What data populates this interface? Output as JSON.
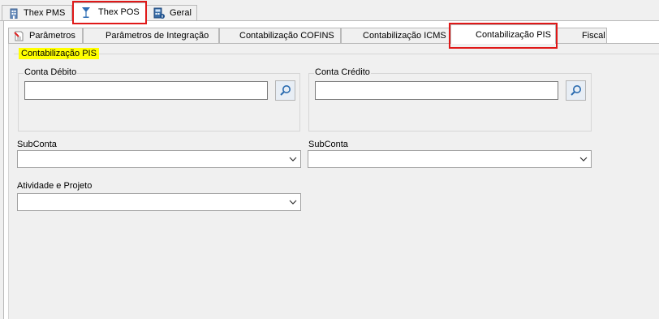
{
  "top_tabs": [
    {
      "label": "Thex PMS",
      "icon": "building-icon"
    },
    {
      "label": "Thex POS",
      "icon": "cocktail-glass-icon",
      "active": true
    },
    {
      "label": "Geral",
      "icon": "calculator-icon"
    }
  ],
  "inner_tabs": [
    {
      "label": "Parâmetros",
      "icon": "document-icon"
    },
    {
      "label": "Parâmetros de Integração"
    },
    {
      "label": "Contabilização COFINS"
    },
    {
      "label": "Contabilização ICMS"
    },
    {
      "label": "Contabilização PIS",
      "active": true
    },
    {
      "label": "Fiscal"
    }
  ],
  "group": {
    "title": "Contabilização PIS",
    "highlight_color": "#ffff00",
    "conta_debito": {
      "label": "Conta Débito",
      "value": ""
    },
    "conta_credito": {
      "label": "Conta Crédito",
      "value": ""
    },
    "subconta_debito": {
      "label": "SubConta",
      "value": ""
    },
    "subconta_credito": {
      "label": "SubConta",
      "value": ""
    },
    "atividade_projeto": {
      "label": "Atividade e Projeto",
      "value": ""
    }
  },
  "colors": {
    "highlight_border": "#e01818"
  }
}
